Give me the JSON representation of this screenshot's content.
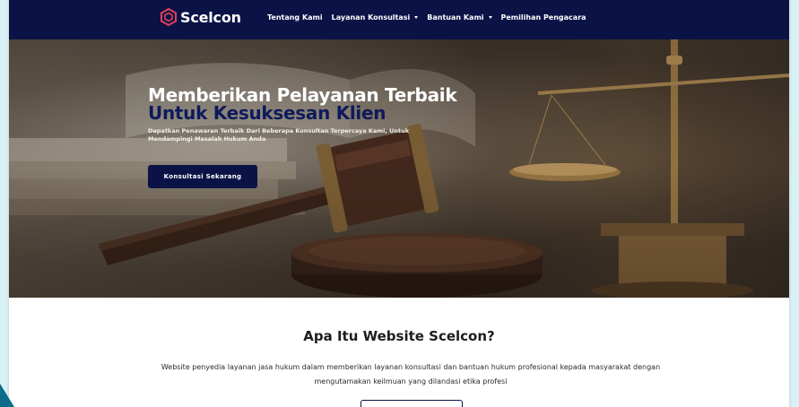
{
  "brand": {
    "name": "Scelcon",
    "logo_icon": "hexagon-logo-icon",
    "logo_color": "#e0405b"
  },
  "nav": {
    "items": [
      {
        "label": "Tentang Kami",
        "has_dropdown": false
      },
      {
        "label": "Layanan Konsultasi",
        "has_dropdown": true
      },
      {
        "label": "Bantuan Kami",
        "has_dropdown": true
      },
      {
        "label": "Pemilihan Pengacara",
        "has_dropdown": false
      }
    ],
    "background": "#0b1346"
  },
  "hero": {
    "title_line1": "Memberikan Pelayanan Terbaik",
    "title_line2": "Untuk Kesuksesan Klien",
    "description": "Dapatkan Penawaran Terbaik Dari Beberapa Konsultan Terpercaya Kami, Untuk Mendampingi Masalah Hukum Anda",
    "cta_label": "Konsultasi Sekarang",
    "image": "gavel-and-scales-of-justice-on-law-books"
  },
  "about": {
    "title": "Apa Itu Website Scelcon?",
    "text": "Website penyedia layanan jasa hukum dalam memberikan layanan konsultasi dan bantuan hukum profesional kepada masyarakat dengan mengutamakan keilmuan yang dilandasi etika profesi"
  },
  "colors": {
    "primary": "#0b1346",
    "accent": "#e0405b",
    "page_background": "#d9f0f4"
  }
}
